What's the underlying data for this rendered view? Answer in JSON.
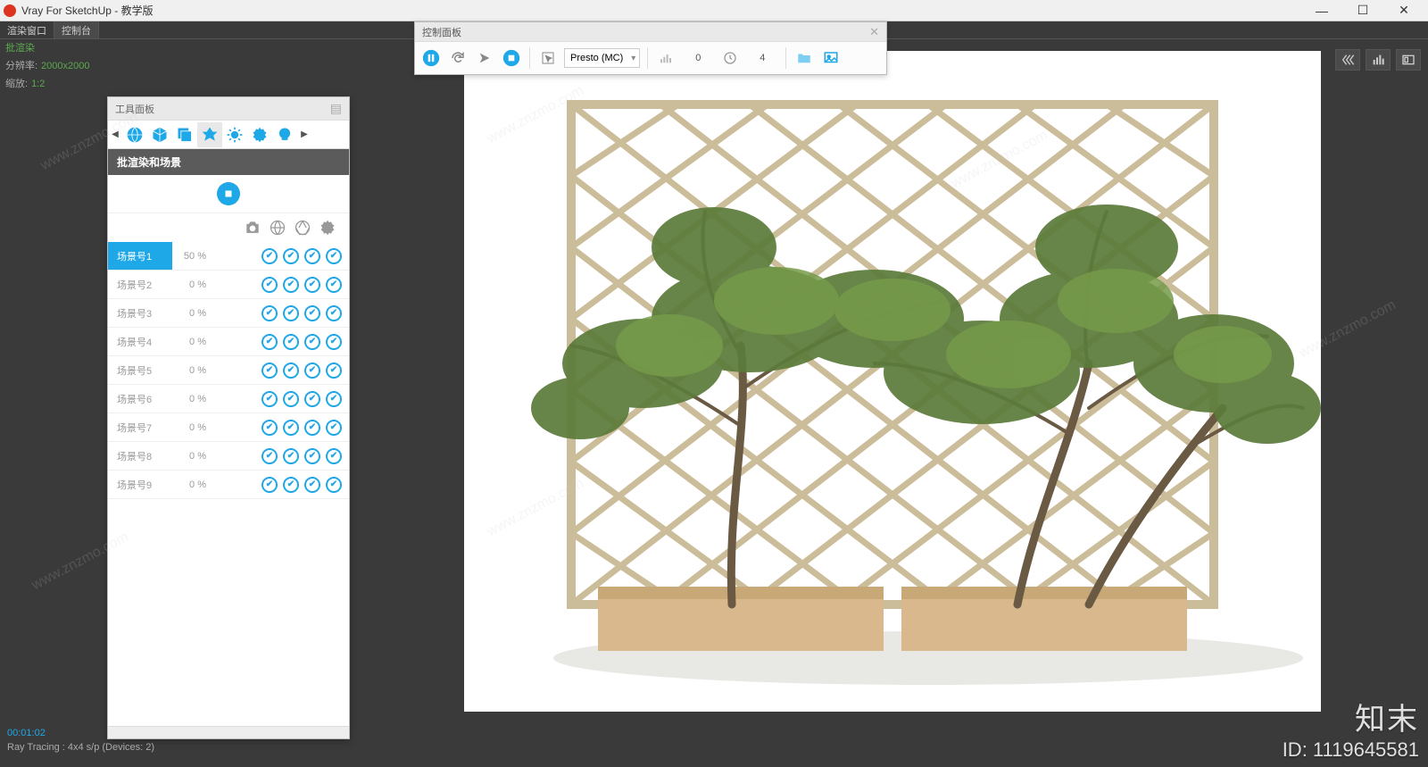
{
  "titlebar": {
    "title": "Vray For SketchUp - 教学版"
  },
  "menubar": {
    "tab1": "渲染窗口",
    "tab2": "控制台"
  },
  "info": {
    "batch_label": "批渲染",
    "res_label": "分辨率:",
    "res_value": "2000x2000",
    "zoom_label": "缩放:",
    "zoom_value": "1:2"
  },
  "control_panel": {
    "title": "控制面板",
    "engine": "Presto (MC)",
    "num1": "0",
    "num2": "4"
  },
  "tool_panel": {
    "title": "工具面板",
    "section": "批渲染和场景",
    "scenes": [
      {
        "name": "场景号1",
        "pct": "50 %",
        "active": true
      },
      {
        "name": "场景号2",
        "pct": "0 %",
        "active": false
      },
      {
        "name": "场景号3",
        "pct": "0 %",
        "active": false
      },
      {
        "name": "场景号4",
        "pct": "0 %",
        "active": false
      },
      {
        "name": "场景号5",
        "pct": "0 %",
        "active": false
      },
      {
        "name": "场景号6",
        "pct": "0 %",
        "active": false
      },
      {
        "name": "场景号7",
        "pct": "0 %",
        "active": false
      },
      {
        "name": "场景号8",
        "pct": "0 %",
        "active": false
      },
      {
        "name": "场景号9",
        "pct": "0 %",
        "active": false
      }
    ]
  },
  "status": {
    "time": "00:01:02",
    "line2": "Ray Tracing : 4x4 s/p (Devices: 2)"
  },
  "watermark": {
    "brand": "知末",
    "id": "ID: 1119645581",
    "url": "www.znzmo.com"
  }
}
